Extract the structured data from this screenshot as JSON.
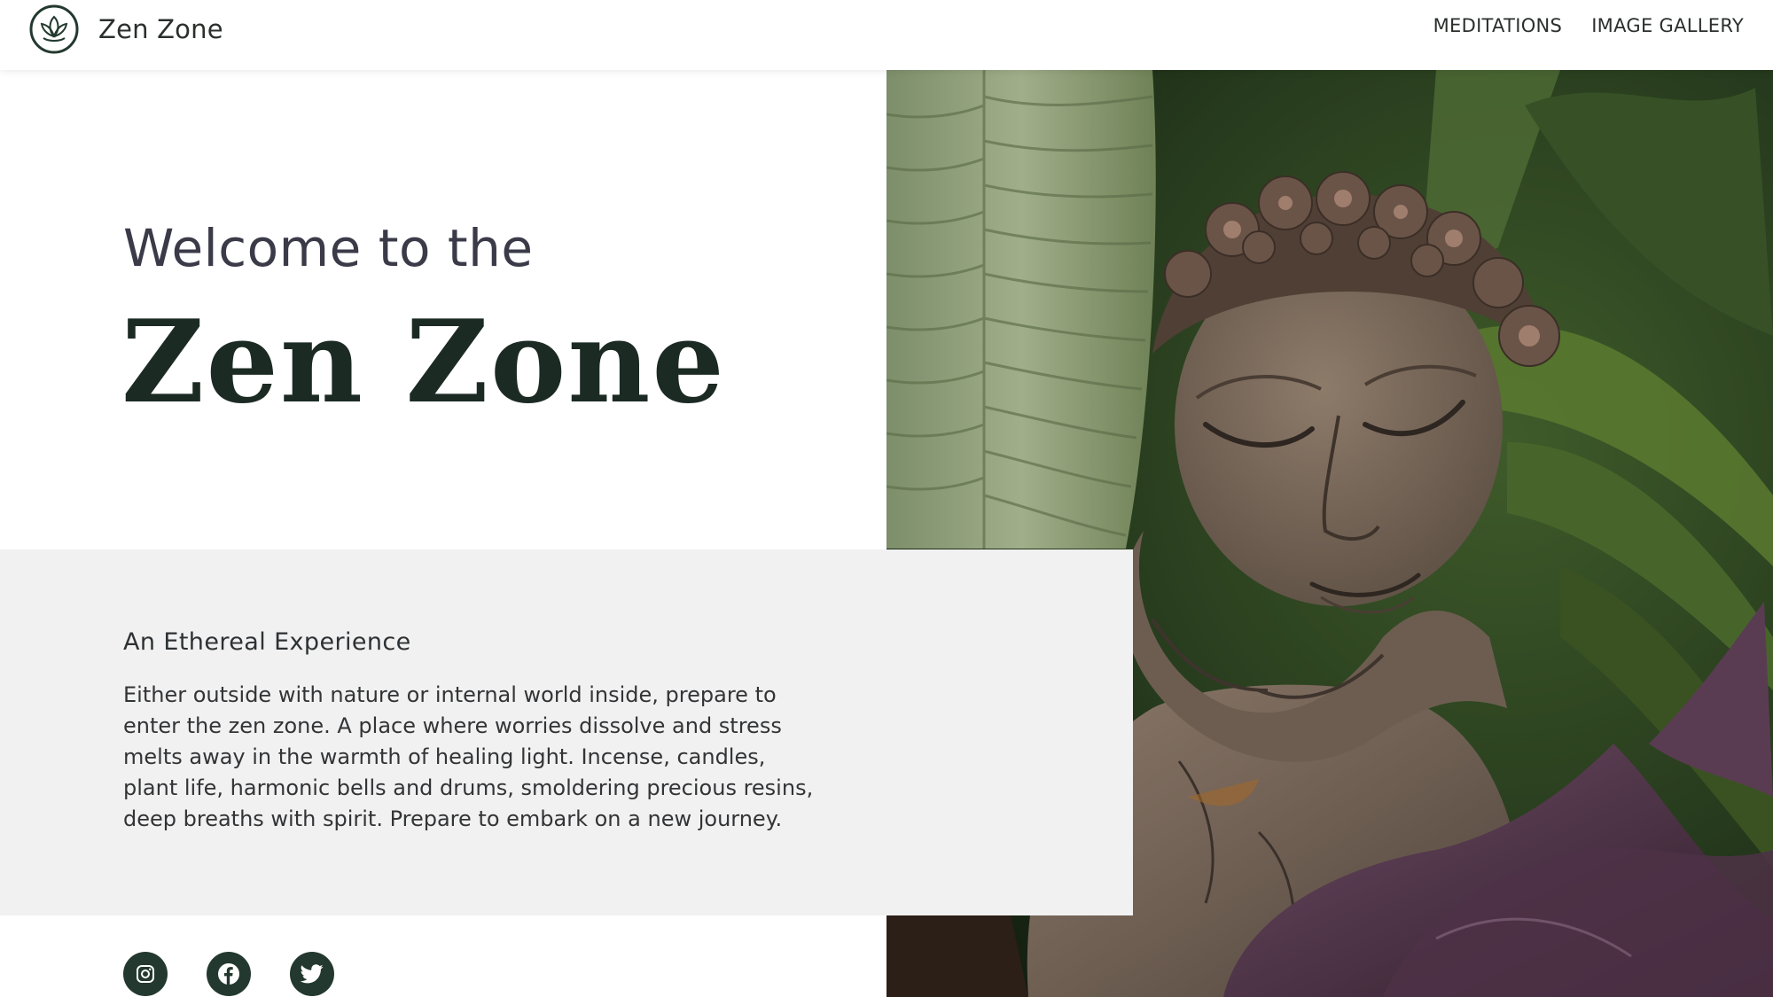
{
  "header": {
    "brand_name": "Zen Zone",
    "logo_icon": "lotus-icon",
    "nav": [
      {
        "label": "MEDITATIONS"
      },
      {
        "label": "IMAGE GALLERY"
      }
    ]
  },
  "hero": {
    "welcome": "Welcome to the",
    "title": "Zen Zone",
    "image_subject": "stone-buddha-statue-image"
  },
  "panel": {
    "heading": "An Ethereal Experience",
    "body": "Either outside with nature or internal world inside, prepare to enter the zen zone. A place where worries dissolve and stress melts away in the warmth of healing light. Incense, candles, plant life, harmonic bells and drums, smoldering precious resins, deep breaths with spirit. Prepare to embark on a new journey."
  },
  "social": [
    {
      "icon": "instagram-icon"
    },
    {
      "icon": "facebook-icon"
    },
    {
      "icon": "twitter-icon"
    }
  ],
  "colors": {
    "brand_dark_green": "#23392f",
    "panel_grey": "#f1f1f1",
    "title_text": "#1c2a24"
  }
}
